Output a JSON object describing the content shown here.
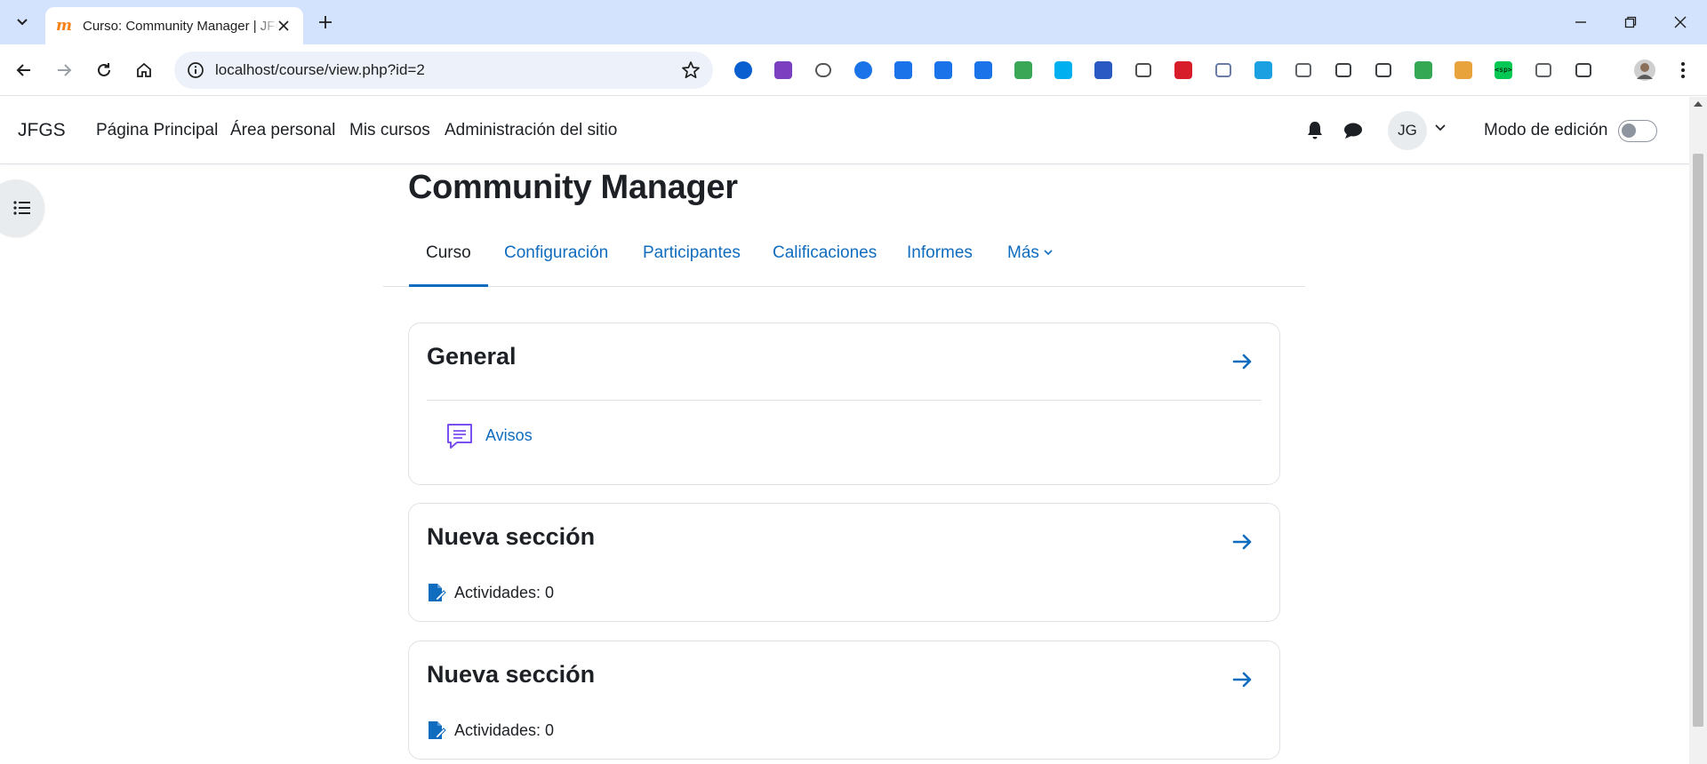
{
  "browser": {
    "tab_title": "Curso: Community Manager | JFGS",
    "url": "localhost/course/view.php?id=2",
    "extension_icons": [
      {
        "name": "password-manager-icon",
        "color": "#0a5fd0"
      },
      {
        "name": "onenote-icon",
        "color": "#7b3fbf"
      },
      {
        "name": "cloud-icon",
        "color": "#555555"
      },
      {
        "name": "profile-extension-icon",
        "color": "#1a73e8"
      },
      {
        "name": "download-extension-icon",
        "color": "#1a73e8"
      },
      {
        "name": "save-icon",
        "color": "#1a73e8"
      },
      {
        "name": "file-icon",
        "color": "#1a73e8"
      },
      {
        "name": "tool-icon",
        "color": "#3aa757"
      },
      {
        "name": "skype-icon",
        "color": "#00aff0"
      },
      {
        "name": "link-icon",
        "color": "#2b59c3"
      },
      {
        "name": "bike-icon",
        "color": "#4e4e4e"
      },
      {
        "name": "mendeley-icon",
        "color": "#d71d2a"
      },
      {
        "name": "notes-icon",
        "color": "#6b7ba8"
      },
      {
        "name": "s-extension-icon",
        "color": "#1ba0e2"
      },
      {
        "name": "document-icon",
        "color": "#5f6368"
      },
      {
        "name": "download-arrow-icon",
        "color": "#3c4043"
      },
      {
        "name": "umbrella-icon",
        "color": "#3c4043"
      },
      {
        "name": "puzzle-green-icon",
        "color": "#34a853"
      },
      {
        "name": "sitemap-icon",
        "color": "#e8a33d"
      },
      {
        "name": "sp-extension-icon",
        "color": "#00c853"
      },
      {
        "name": "trash-icon",
        "color": "#5f6368"
      },
      {
        "name": "extensions-icon",
        "color": "#3c4043"
      }
    ],
    "sp_label": "<sp>"
  },
  "moodle": {
    "brand": "JFGS",
    "primary_nav": [
      "Página Principal",
      "Área personal",
      "Mis cursos",
      "Administración del sitio"
    ],
    "user_initials": "JG",
    "edit_mode_label": "Modo de edición",
    "course_title": "Community Manager",
    "secondary_nav": [
      "Curso",
      "Configuración",
      "Participantes",
      "Calificaciones",
      "Informes",
      "Más"
    ],
    "sections": [
      {
        "title": "General",
        "activities": [
          {
            "label": "Avisos"
          }
        ]
      },
      {
        "title": "Nueva sección",
        "count_label": "Actividades: 0"
      },
      {
        "title": "Nueva sección",
        "count_label": "Actividades: 0"
      }
    ]
  },
  "colors": {
    "link": "#0f6cbf",
    "text": "#1d2125",
    "tabstrip": "#d3e3fd",
    "forum_icon": "#7b4ef0"
  }
}
